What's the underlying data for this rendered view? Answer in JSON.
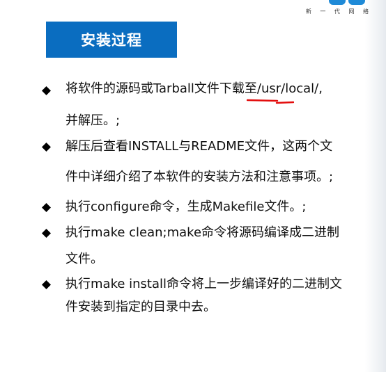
{
  "logo": {
    "caption": "新 一 代 网 络"
  },
  "title": "安装过程",
  "items": [
    {
      "lines": [
        [
          "将软件的源码或Tarball文件下载",
          "至/usr/",
          "local/,"
        ],
        [
          "并解压。;"
        ]
      ]
    },
    {
      "lines": [
        [
          "解压后查看INSTALL与README文件，这两个文"
        ],
        [
          "件中详细介绍了本软件的安装方法和注意事项。;"
        ]
      ]
    },
    {
      "lines": [
        [
          "执行configure命令，生成Makefile文件。;"
        ]
      ]
    },
    {
      "lines": [
        [
          "执行make clean;make命令将源码编译成二进制"
        ],
        [
          "文件。"
        ]
      ]
    },
    {
      "lines": [
        [
          "执行make install命令将上一步编译好的二进制文"
        ],
        [
          "件安装到指定的目录中去。"
        ]
      ]
    }
  ],
  "colors": {
    "title_bg": "#0a6dc0",
    "title_text": "#ffffff",
    "annotation": "#e30d0d",
    "logo_blue": "#1f8ad7"
  },
  "icons": {
    "bullet": "diamond-bullet-icon",
    "annotation": "red-underline-mark"
  }
}
